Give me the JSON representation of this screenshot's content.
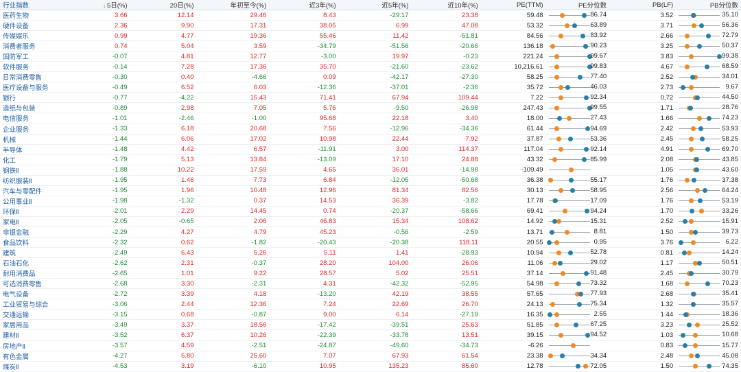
{
  "headers": {
    "name": "行业指数",
    "d5": "5日(%)",
    "d20": "20日(%)",
    "ytd": "年初至今(%)",
    "y3": "近3年(%)",
    "y5": "近5年(%)",
    "y10": "近10年(%)",
    "pe": "PE(TTM)",
    "pe_pct": "PE分位数",
    "pb": "PB(LF)",
    "pb_pct": "PB分位数"
  },
  "sort_icon": "down-arrow",
  "colors": {
    "up": "#e02020",
    "down": "#1a8a35",
    "current": "#2a7fa8",
    "median": "#f08a24"
  },
  "rows": [
    {
      "name": "医药生物",
      "d5": "3.66",
      "d20": "12.14",
      "ytd": "29.46",
      "y3": "8.43",
      "y5": "-29.17",
      "y10": "23.38",
      "pe": "59.48",
      "pe_pct": "86.74",
      "pe_dot": 0.87,
      "pe_med": 0.33,
      "pb": "3.52",
      "pb_pct": "35.10",
      "pb_dot": 0.35,
      "pb_med": 0.38
    },
    {
      "name": "硬件设备",
      "d5": "2.36",
      "d20": "9.90",
      "ytd": "17.31",
      "y3": "38.05",
      "y5": "6.99",
      "y10": "47.08",
      "pe": "53.32",
      "pe_pct": "63.89",
      "pe_dot": 0.64,
      "pe_med": 0.45,
      "pb": "3.71",
      "pb_pct": "56.36",
      "pb_dot": 0.56,
      "pb_med": 0.38
    },
    {
      "name": "传媒娱乐",
      "d5": "0.99",
      "d20": "4.77",
      "ytd": "19.36",
      "y3": "55.46",
      "y5": "11.42",
      "y10": "-51.81",
      "pe": "84.56",
      "pe_pct": "83.92",
      "pe_dot": 0.84,
      "pe_med": 0.3,
      "pb": "2.66",
      "pb_pct": "72.79",
      "pb_dot": 0.73,
      "pb_med": 0.2
    },
    {
      "name": "消费者服务",
      "d5": "0.74",
      "d20": "5.04",
      "ytd": "3.59",
      "y3": "-34.79",
      "y5": "-51.56",
      "y10": "-20.66",
      "pe": "136.18",
      "pe_pct": "90.23",
      "pe_dot": 0.9,
      "pe_med": 0.1,
      "pb": "3.25",
      "pb_pct": "50.37",
      "pb_dot": 0.5,
      "pb_med": 0.2
    },
    {
      "name": "国防军工",
      "d5": "-0.07",
      "d20": "4.81",
      "ytd": "12.77",
      "y3": "-3.00",
      "y5": "19.97",
      "y10": "-0.23",
      "pe": "221.24",
      "pe_pct": "99.67",
      "pe_dot": 0.995,
      "pe_med": 0.2,
      "pb": "3.83",
      "pb_pct": "99.38",
      "pb_dot": 0.995,
      "pb_med": 0.3
    },
    {
      "name": "软件服务",
      "d5": "-0.14",
      "d20": "7.28",
      "ytd": "17.36",
      "y3": "35.70",
      "y5": "-21.60",
      "y10": "-23.62",
      "pe": "10,216.61",
      "pe_pct": "99.83",
      "pe_dot": 0.995,
      "pe_med": 0.2,
      "pb": "4.67",
      "pb_pct": "68.59",
      "pb_dot": 0.69,
      "pb_med": 0.2
    },
    {
      "name": "日常消费零售",
      "d5": "-0.30",
      "d20": "0.40",
      "ytd": "-4.66",
      "y3": "0.09",
      "y5": "-42.17",
      "y10": "-27.30",
      "pe": "58.25",
      "pe_pct": "77.40",
      "pe_dot": 0.77,
      "pe_med": 0.2,
      "pb": "2.52",
      "pb_pct": "34.01",
      "pb_dot": 0.34,
      "pb_med": 0.4
    },
    {
      "name": "医疗设备与服务",
      "d5": "-0.49",
      "d20": "6.52",
      "ytd": "6.03",
      "y3": "-12.36",
      "y5": "-37.01",
      "y10": "-2.36",
      "pe": "35.72",
      "pe_pct": "46.03",
      "pe_dot": 0.46,
      "pe_med": 0.3,
      "pb": "2.73",
      "pb_pct": "9.67",
      "pb_dot": 0.1,
      "pb_med": 0.3
    },
    {
      "name": "银行",
      "d5": "-0.77",
      "d20": "-4.22",
      "ytd": "15.43",
      "y3": "71.41",
      "y5": "67.94",
      "y10": "109.44",
      "pe": "7.22",
      "pe_pct": "92.34",
      "pe_dot": 0.92,
      "pe_med": 0.3,
      "pb": "0.72",
      "pb_pct": "44.50",
      "pb_dot": 0.45,
      "pb_med": 0.4
    },
    {
      "name": "造纸与包装",
      "d5": "-0.89",
      "d20": "2.98",
      "ytd": "7.05",
      "y3": "5.76",
      "y5": "-9.50",
      "y10": "-26.98",
      "pe": "247.43",
      "pe_pct": "99.55",
      "pe_dot": 0.995,
      "pe_med": 0.2,
      "pb": "1.71",
      "pb_pct": "28.76",
      "pb_dot": 0.29,
      "pb_med": 0.25
    },
    {
      "name": "电信服务",
      "d5": "-1.01",
      "d20": "-2.46",
      "ytd": "-1.00",
      "y3": "95.68",
      "y5": "22.18",
      "y10": "3.40",
      "pe": "18.00",
      "pe_pct": "27.43",
      "pe_dot": 0.27,
      "pe_med": 0.5,
      "pb": "1.66",
      "pb_pct": "74.23",
      "pb_dot": 0.74,
      "pb_med": 0.5
    },
    {
      "name": "企业服务",
      "d5": "-1.33",
      "d20": "6.18",
      "ytd": "20.68",
      "y3": "7.56",
      "y5": "-12.96",
      "y10": "-34.36",
      "pe": "61.44",
      "pe_pct": "94.69",
      "pe_dot": 0.95,
      "pe_med": 0.2,
      "pb": "2.42",
      "pb_pct": "53.93",
      "pb_dot": 0.54,
      "pb_med": 0.35
    },
    {
      "name": "机械",
      "d5": "-1.44",
      "d20": "6.06",
      "ytd": "17.02",
      "y3": "10.98",
      "y5": "22.44",
      "y10": "7.92",
      "pe": "37.87",
      "pe_pct": "53.36",
      "pe_dot": 0.53,
      "pe_med": 0.25,
      "pb": "2.45",
      "pb_pct": "58.25",
      "pb_dot": 0.58,
      "pb_med": 0.3
    },
    {
      "name": "半导体",
      "d5": "-1.48",
      "d20": "4.42",
      "ytd": "6.57",
      "y3": "-11.91",
      "y5": "3.00",
      "y10": "114.37",
      "pe": "117.04",
      "pe_pct": "92.14",
      "pe_dot": 0.92,
      "pe_med": 0.3,
      "pb": "4.91",
      "pb_pct": "69.70",
      "pb_dot": 0.7,
      "pb_med": 0.3
    },
    {
      "name": "化工",
      "d5": "-1.79",
      "d20": "5.13",
      "ytd": "13.84",
      "y3": "-13.09",
      "y5": "17.10",
      "y10": "24.88",
      "pe": "43.32",
      "pe_pct": "85.99",
      "pe_dot": 0.86,
      "pe_med": 0.15,
      "pb": "2.08",
      "pb_pct": "43.85",
      "pb_dot": 0.44,
      "pb_med": 0.4
    },
    {
      "name": "钢铁Ⅱ",
      "d5": "-1.88",
      "d20": "10.22",
      "ytd": "17.59",
      "y3": "4.65",
      "y5": "36.01",
      "y10": "-14.98",
      "pe": "-109.49",
      "pe_pct": "",
      "pe_dot": null,
      "pe_med": 0.55,
      "pb": "1.05",
      "pb_pct": "43.60",
      "pb_dot": 0.44,
      "pb_med": 0.4
    },
    {
      "name": "纺织服装Ⅱ",
      "d5": "-1.95",
      "d20": "1.46",
      "ytd": "7.73",
      "y3": "6.84",
      "y5": "-12.05",
      "y10": "-50.68",
      "pe": "36.38",
      "pe_pct": "55.17",
      "pe_dot": 0.55,
      "pe_med": 0.05,
      "pb": "1.76",
      "pb_pct": "37.38",
      "pb_dot": 0.37,
      "pb_med": 0.2
    },
    {
      "name": "汽车与零配件",
      "d5": "-1.95",
      "d20": "1.96",
      "ytd": "10.48",
      "y3": "12.96",
      "y5": "81.34",
      "y10": "82.56",
      "pe": "30.13",
      "pe_pct": "58.95",
      "pe_dot": 0.59,
      "pe_med": 0.3,
      "pb": "2.56",
      "pb_pct": "64.24",
      "pb_dot": 0.64,
      "pb_med": 0.45
    },
    {
      "name": "公用事业Ⅱ",
      "d5": "-1.98",
      "d20": "-1.32",
      "ytd": "0.37",
      "y3": "14.53",
      "y5": "36.39",
      "y10": "-3.82",
      "pe": "17.78",
      "pe_pct": "17.09",
      "pe_dot": 0.17,
      "pe_med": 0.15,
      "pb": "1.76",
      "pb_pct": "53.19",
      "pb_dot": 0.53,
      "pb_med": 0.3
    },
    {
      "name": "环保Ⅱ",
      "d5": "-2.01",
      "d20": "2.29",
      "ytd": "14.45",
      "y3": "0.74",
      "y5": "-20.37",
      "y10": "-58.66",
      "pe": "69.41",
      "pe_pct": "94.24",
      "pe_dot": 0.94,
      "pe_med": 0.4,
      "pb": "1.70",
      "pb_pct": "33.26",
      "pb_dot": 0.33,
      "pb_med": 0.55
    },
    {
      "name": "家电Ⅱ",
      "d5": "-2.05",
      "d20": "-0.65",
      "ytd": "2.06",
      "y3": "46.83",
      "y5": "15.34",
      "y10": "108.62",
      "pe": "14.92",
      "pe_pct": "15.31",
      "pe_dot": 0.15,
      "pe_med": 0.25,
      "pb": "2.52",
      "pb_pct": "15.91",
      "pb_dot": 0.16,
      "pb_med": 0.3
    },
    {
      "name": "非银金融",
      "d5": "-2.29",
      "d20": "4.27",
      "ytd": "4.79",
      "y3": "45.23",
      "y5": "-0.56",
      "y10": "-2.59",
      "pe": "13.71",
      "pe_pct": "8.81",
      "pe_dot": 0.09,
      "pe_med": 0.45,
      "pb": "1.50",
      "pb_pct": "39.73",
      "pb_dot": 0.4,
      "pb_med": 0.3
    },
    {
      "name": "食品饮料",
      "d5": "-2.32",
      "d20": "0.62",
      "ytd": "-1.82",
      "y3": "-20.43",
      "y5": "-20.38",
      "y10": "118.11",
      "pe": "20.55",
      "pe_pct": "0.95",
      "pe_dot": 0.01,
      "pe_med": 0.2,
      "pb": "3.76",
      "pb_pct": "6.22",
      "pb_dot": 0.06,
      "pb_med": 0.35
    },
    {
      "name": "建筑",
      "d5": "-2.49",
      "d20": "6.43",
      "ytd": "5.26",
      "y3": "5.11",
      "y5": "1.41",
      "y10": "-28.93",
      "pe": "10.94",
      "pe_pct": "52.78",
      "pe_dot": 0.53,
      "pe_med": 0.25,
      "pb": "0.81",
      "pb_pct": "14.24",
      "pb_dot": 0.14,
      "pb_med": 0.25
    },
    {
      "name": "石油石化",
      "d5": "-2.62",
      "d20": "2.31",
      "ytd": "-0.37",
      "y3": "28.20",
      "y5": "104.00",
      "y10": "26.06",
      "pe": "11.06",
      "pe_pct": "29.02",
      "pe_dot": 0.29,
      "pe_med": 0.15,
      "pb": "1.17",
      "pb_pct": "50.51",
      "pb_dot": 0.51,
      "pb_med": 0.4
    },
    {
      "name": "耐用消费品",
      "d5": "-2.65",
      "d20": "1.01",
      "ytd": "9.22",
      "y3": "28.57",
      "y5": "5.02",
      "y10": "25.51",
      "pe": "37.14",
      "pe_pct": "91.48",
      "pe_dot": 0.91,
      "pe_med": 0.35,
      "pb": "2.45",
      "pb_pct": "30.79",
      "pb_dot": 0.31,
      "pb_med": 0.25
    },
    {
      "name": "可选消费零售",
      "d5": "-2.68",
      "d20": "3.30",
      "ytd": "-2.31",
      "y3": "4.31",
      "y5": "-42.32",
      "y10": "-52.95",
      "pe": "54.98",
      "pe_pct": "73.32",
      "pe_dot": 0.73,
      "pe_med": 0.2,
      "pb": "1.68",
      "pb_pct": "70.23",
      "pb_dot": 0.7,
      "pb_med": 0.2
    },
    {
      "name": "电气设备",
      "d5": "-2.72",
      "d20": "3.39",
      "ytd": "4.18",
      "y3": "-13.20",
      "y5": "42.19",
      "y10": "38.55",
      "pe": "57.65",
      "pe_pct": "77.93",
      "pe_dot": 0.78,
      "pe_med": 0.7,
      "pb": "2.68",
      "pb_pct": "35.41",
      "pb_dot": 0.35,
      "pb_med": 0.37
    },
    {
      "name": "工业贸易与综合",
      "d5": "-3.06",
      "d20": "2.44",
      "ytd": "12.36",
      "y3": "7.24",
      "y5": "22.69",
      "y10": "26.70",
      "pe": "24.13",
      "pe_pct": "75.34",
      "pe_dot": 0.75,
      "pe_med": 0.1,
      "pb": "1.32",
      "pb_pct": "35.57",
      "pb_dot": 0.36,
      "pb_med": 0.35
    },
    {
      "name": "交通运输",
      "d5": "-3.15",
      "d20": "0.68",
      "ytd": "-0.87",
      "y3": "9.00",
      "y5": "6.14",
      "y10": "-27.19",
      "pe": "16.35",
      "pe_pct": "2.55",
      "pe_dot": 0.03,
      "pe_med": 0.2,
      "pb": "1.44",
      "pb_pct": "18.36",
      "pb_dot": 0.18,
      "pb_med": 0.2
    },
    {
      "name": "家居用品",
      "d5": "-3.49",
      "d20": "3.37",
      "ytd": "18.56",
      "y3": "-17.42",
      "y5": "-39.51",
      "y10": "25.63",
      "pe": "51.85",
      "pe_pct": "67.25",
      "pe_dot": 0.67,
      "pe_med": 0.2,
      "pb": "3.23",
      "pb_pct": "25.52",
      "pb_dot": 0.26,
      "pb_med": 0.45
    },
    {
      "name": "建材Ⅱ",
      "d5": "-3.52",
      "d20": "6.37",
      "ytd": "10.26",
      "y3": "-22.39",
      "y5": "-33.78",
      "y10": "13.51",
      "pe": "39.15",
      "pe_pct": "94.52",
      "pe_dot": 0.95,
      "pe_med": 0.3,
      "pb": "1.03",
      "pb_pct": "10.68",
      "pb_dot": 0.11,
      "pb_med": 0.4
    },
    {
      "name": "房地产Ⅱ",
      "d5": "-3.57",
      "d20": "4.59",
      "ytd": "-2.51",
      "y3": "-24.87",
      "y5": "-49.60",
      "y10": "-34.73",
      "pe": "-6.26",
      "pe_pct": "",
      "pe_dot": null,
      "pe_med": 0.6,
      "pb": "0.83",
      "pb_pct": "15.77",
      "pb_dot": 0.16,
      "pb_med": 0.4
    },
    {
      "name": "有色金属",
      "d5": "-4.27",
      "d20": "5.80",
      "ytd": "25.60",
      "y3": "7.07",
      "y5": "67.93",
      "y10": "61.54",
      "pe": "23.38",
      "pe_pct": "34.34",
      "pe_dot": 0.34,
      "pe_med": 0.05,
      "pb": "2.48",
      "pb_pct": "45.08",
      "pb_dot": 0.45,
      "pb_med": 0.3
    },
    {
      "name": "煤炭Ⅱ",
      "d5": "-4.53",
      "d20": "3.19",
      "ytd": "-6.10",
      "y3": "10.95",
      "y5": "135.23",
      "y10": "85.60",
      "pe": "12.78",
      "pe_pct": "72.05",
      "pe_dot": 0.72,
      "pe_med": 0.9,
      "pb": "1.50",
      "pb_pct": "74.35",
      "pb_dot": 0.74,
      "pb_med": 0.4
    }
  ]
}
